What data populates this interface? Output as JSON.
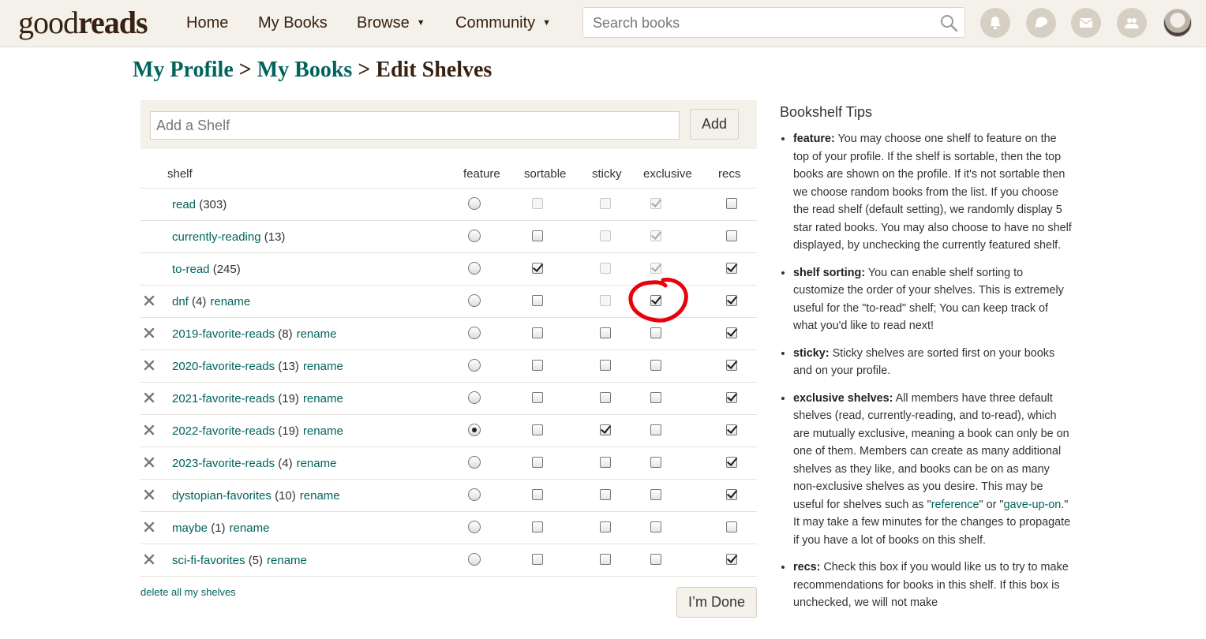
{
  "header": {
    "logo_part1": "good",
    "logo_part2": "reads",
    "nav": {
      "home": "Home",
      "my_books": "My Books",
      "browse": "Browse",
      "community": "Community"
    },
    "search": {
      "placeholder": "Search books",
      "value": ""
    },
    "icons": [
      "bell-icon",
      "chat-icon",
      "mail-icon",
      "friends-icon"
    ]
  },
  "breadcrumb": {
    "profile": "My Profile",
    "sep": ">",
    "books": "My Books",
    "current": "Edit Shelves"
  },
  "add_shelf": {
    "placeholder": "Add a Shelf",
    "value": "",
    "button": "Add"
  },
  "table": {
    "headers": {
      "shelf": "shelf",
      "feature": "feature",
      "sortable": "sortable",
      "sticky": "sticky",
      "exclusive": "exclusive",
      "recs": "recs"
    },
    "rename_label": "rename",
    "rows": [
      {
        "name": "read",
        "count": "(303)",
        "deletable": false,
        "feature": false,
        "sortable": false,
        "sortable_disabled": true,
        "sticky": false,
        "sticky_disabled": true,
        "exclusive": true,
        "exclusive_disabled": true,
        "recs": false
      },
      {
        "name": "currently-reading",
        "count": "(13)",
        "deletable": false,
        "feature": false,
        "sortable": false,
        "sortable_disabled": false,
        "sticky": false,
        "sticky_disabled": true,
        "exclusive": true,
        "exclusive_disabled": true,
        "recs": false
      },
      {
        "name": "to-read",
        "count": "(245)",
        "deletable": false,
        "feature": false,
        "sortable": true,
        "sortable_disabled": false,
        "sticky": false,
        "sticky_disabled": true,
        "exclusive": true,
        "exclusive_disabled": true,
        "recs": true
      },
      {
        "name": "dnf",
        "count": "(4)",
        "deletable": true,
        "feature": false,
        "sortable": false,
        "sortable_disabled": false,
        "sticky": false,
        "sticky_disabled": true,
        "exclusive": true,
        "exclusive_disabled": false,
        "recs": true
      },
      {
        "name": "2019-favorite-reads",
        "count": "(8)",
        "deletable": true,
        "feature": false,
        "sortable": false,
        "sortable_disabled": false,
        "sticky": false,
        "sticky_disabled": false,
        "exclusive": false,
        "exclusive_disabled": false,
        "recs": true
      },
      {
        "name": "2020-favorite-reads",
        "count": "(13)",
        "deletable": true,
        "feature": false,
        "sortable": false,
        "sortable_disabled": false,
        "sticky": false,
        "sticky_disabled": false,
        "exclusive": false,
        "exclusive_disabled": false,
        "recs": true
      },
      {
        "name": "2021-favorite-reads",
        "count": "(19)",
        "deletable": true,
        "feature": false,
        "sortable": false,
        "sortable_disabled": false,
        "sticky": false,
        "sticky_disabled": false,
        "exclusive": false,
        "exclusive_disabled": false,
        "recs": true
      },
      {
        "name": "2022-favorite-reads",
        "count": "(19)",
        "deletable": true,
        "feature": true,
        "sortable": false,
        "sortable_disabled": false,
        "sticky": true,
        "sticky_disabled": false,
        "exclusive": false,
        "exclusive_disabled": false,
        "recs": true
      },
      {
        "name": "2023-favorite-reads",
        "count": "(4)",
        "deletable": true,
        "feature": false,
        "sortable": false,
        "sortable_disabled": false,
        "sticky": false,
        "sticky_disabled": false,
        "exclusive": false,
        "exclusive_disabled": false,
        "recs": true
      },
      {
        "name": "dystopian-favorites",
        "count": "(10)",
        "deletable": true,
        "feature": false,
        "sortable": false,
        "sortable_disabled": false,
        "sticky": false,
        "sticky_disabled": false,
        "exclusive": false,
        "exclusive_disabled": false,
        "recs": true
      },
      {
        "name": "maybe",
        "count": "(1)",
        "deletable": true,
        "feature": false,
        "sortable": false,
        "sortable_disabled": false,
        "sticky": false,
        "sticky_disabled": false,
        "exclusive": false,
        "exclusive_disabled": false,
        "recs": false
      },
      {
        "name": "sci-fi-favorites",
        "count": "(5)",
        "deletable": true,
        "feature": false,
        "sortable": false,
        "sortable_disabled": false,
        "sticky": false,
        "sticky_disabled": false,
        "exclusive": false,
        "exclusive_disabled": false,
        "recs": true
      }
    ]
  },
  "footer": {
    "delete_all": "delete all my shelves",
    "done": "I’m Done"
  },
  "annotation_color": "#e8000b",
  "tips": {
    "title": "Bookshelf Tips",
    "items": [
      {
        "term": "feature:",
        "text": " You may choose one shelf to feature on the top of your profile. If the shelf is sortable, then the top books are shown on the profile. If it's not sortable then we choose random books from the list. If you choose the read shelf (default setting), we randomly display 5 star rated books. You may also choose to have no shelf displayed, by unchecking the currently featured shelf."
      },
      {
        "term": "shelf sorting:",
        "text": " You can enable shelf sorting to customize the order of your shelves. This is extremely useful for the \"to-read\" shelf; You can keep track of what you'd like to read next!"
      },
      {
        "term": "sticky:",
        "text": " Sticky shelves are sorted first on your books and on your profile."
      },
      {
        "term": "exclusive shelves:",
        "text": " All members have three default shelves (read, currently-reading, and to-read), which are mutually exclusive, meaning a book can only be on one of them. Members can create as many additional shelves as they like, and books can be on as many non-exclusive shelves as you desire. This may be useful for shelves such as \"",
        "link1": "reference",
        "text2": "\" or \"",
        "link2": "gave-up-on",
        "text3": ".\" It may take a few minutes for the changes to propagate if you have a lot of books on this shelf."
      },
      {
        "term": "recs:",
        "text": " Check this box if you would like us to try to make recommendations for books in this shelf. If this box is unchecked, we will not make"
      }
    ]
  }
}
